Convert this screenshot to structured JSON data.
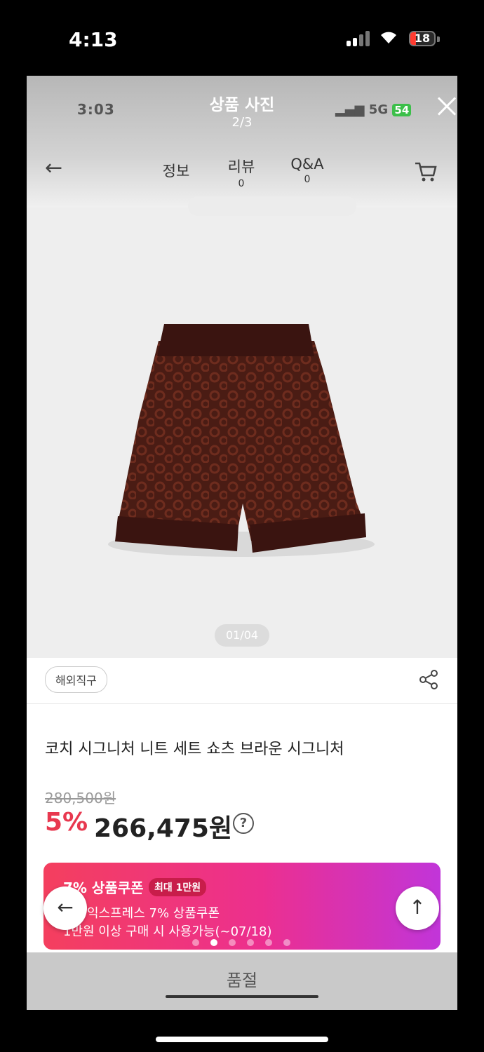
{
  "status_bar": {
    "time": "4:13",
    "battery": "18"
  },
  "inner_status": {
    "time": "3:03",
    "network": "5G",
    "battery": "54"
  },
  "photo_viewer": {
    "title": "상품 사진",
    "counter": "2/3"
  },
  "nav": {
    "tabs": [
      {
        "label": "정보",
        "count": ""
      },
      {
        "label": "리뷰",
        "count": "0"
      },
      {
        "label": "Q&A",
        "count": "0"
      }
    ]
  },
  "product": {
    "image_indicator": "01/04",
    "tag": "해외직구",
    "name": "코치 시그니처 니트 세트 쇼츠 브라운 시그니처",
    "original_price": "280,500원",
    "discount": "5%",
    "sale_price": "266,475원",
    "help_symbol": "?"
  },
  "coupon": {
    "title": "7% 상품쿠폰",
    "badge": "최대 1만원",
    "line1": "익스프레스 7% 상품쿠폰",
    "line2": "1만원 이상 구매 시 사용가능(~07/18)",
    "carousel_active": 1
  },
  "footer": {
    "soldout_label": "품절"
  },
  "colors": {
    "accent": "#e8384f",
    "coupon_start": "#f43f5e",
    "coupon_end": "#c135d9"
  }
}
